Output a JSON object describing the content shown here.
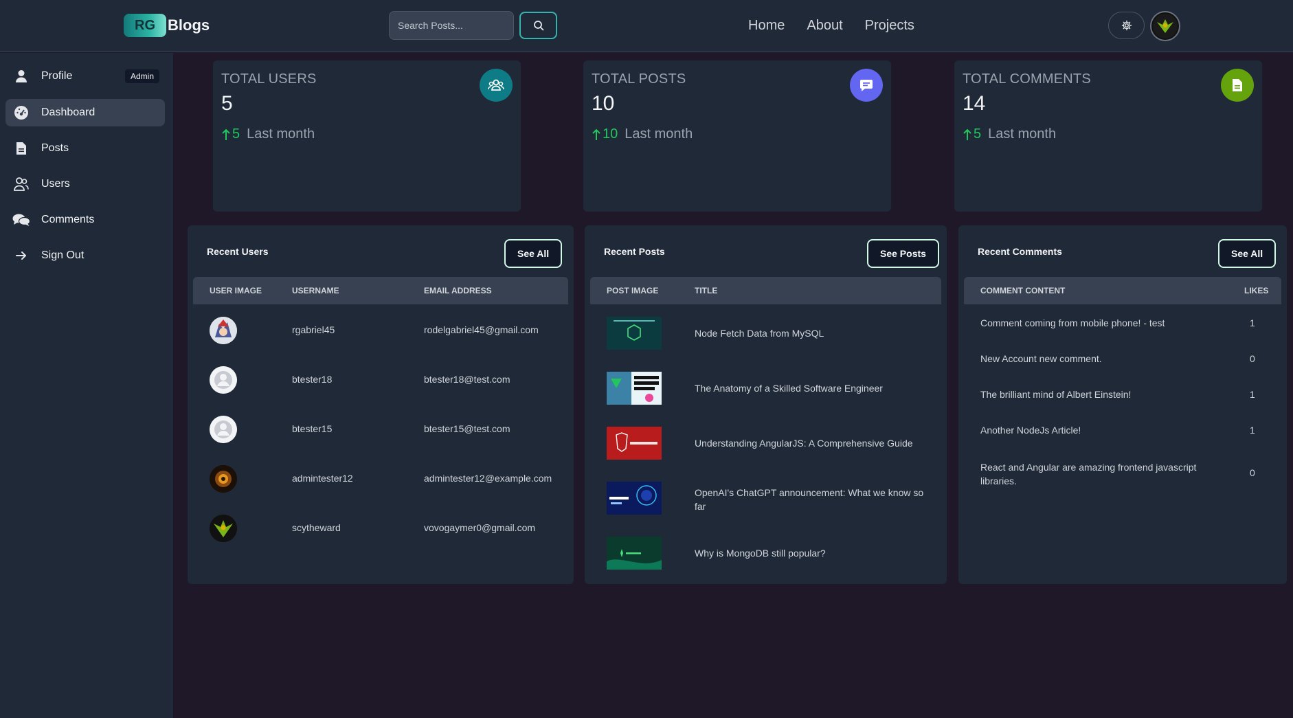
{
  "header": {
    "logo_badge": "RG",
    "logo_text": "Blogs",
    "search_placeholder": "Search Posts...",
    "nav": [
      "Home",
      "About",
      "Projects"
    ]
  },
  "sidebar": {
    "items": [
      {
        "label": "Profile",
        "icon": "user-icon",
        "badge": "Admin"
      },
      {
        "label": "Dashboard",
        "icon": "dashboard-icon",
        "active": true
      },
      {
        "label": "Posts",
        "icon": "document-icon"
      },
      {
        "label": "Users",
        "icon": "users-icon"
      },
      {
        "label": "Comments",
        "icon": "comments-icon"
      },
      {
        "label": "Sign Out",
        "icon": "arrow-right-icon"
      }
    ]
  },
  "stats": [
    {
      "title": "TOTAL USERS",
      "value": "5",
      "trend_value": "5",
      "trend_label": "Last month",
      "icon": "users-group-icon",
      "color": "#0e7c86"
    },
    {
      "title": "TOTAL POSTS",
      "value": "10",
      "trend_value": "10",
      "trend_label": "Last month",
      "icon": "chat-icon",
      "color": "#6366f1"
    },
    {
      "title": "TOTAL COMMENTS",
      "value": "14",
      "trend_value": "5",
      "trend_label": "Last month",
      "icon": "document-icon",
      "color": "#65a30d"
    }
  ],
  "recent_users": {
    "title": "Recent Users",
    "button": "See All",
    "columns": [
      "USER IMAGE",
      "USERNAME",
      "EMAIL ADDRESS"
    ],
    "rows": [
      {
        "username": "rgabriel45",
        "email": "rodelgabriel45@gmail.com"
      },
      {
        "username": "btester18",
        "email": "btester18@test.com"
      },
      {
        "username": "btester15",
        "email": "btester15@test.com"
      },
      {
        "username": "admintester12",
        "email": "admintester12@example.com"
      },
      {
        "username": "scytheward",
        "email": "vovogaymer0@gmail.com"
      }
    ]
  },
  "recent_posts": {
    "title": "Recent Posts",
    "button": "See Posts",
    "columns": [
      "POST IMAGE",
      "TITLE"
    ],
    "rows": [
      {
        "title": "Node Fetch Data from MySQL"
      },
      {
        "title": "The Anatomy of a Skilled Software Engineer"
      },
      {
        "title": "Understanding AngularJS: A Comprehensive Guide"
      },
      {
        "title": "OpenAI's ChatGPT announcement: What we know so far"
      },
      {
        "title": "Why is MongoDB still popular?"
      }
    ]
  },
  "recent_comments": {
    "title": "Recent Comments",
    "button": "See All",
    "columns": [
      "COMMENT CONTENT",
      "LIKES"
    ],
    "rows": [
      {
        "content": "Comment coming from mobile phone! - test",
        "likes": "1"
      },
      {
        "content": "New Account new comment.",
        "likes": "0"
      },
      {
        "content": "The brilliant mind of Albert Einstein!",
        "likes": "1"
      },
      {
        "content": "Another NodeJs Article!",
        "likes": "1"
      },
      {
        "content": "React and Angular are amazing frontend javascript libraries.",
        "likes": "0"
      }
    ]
  }
}
